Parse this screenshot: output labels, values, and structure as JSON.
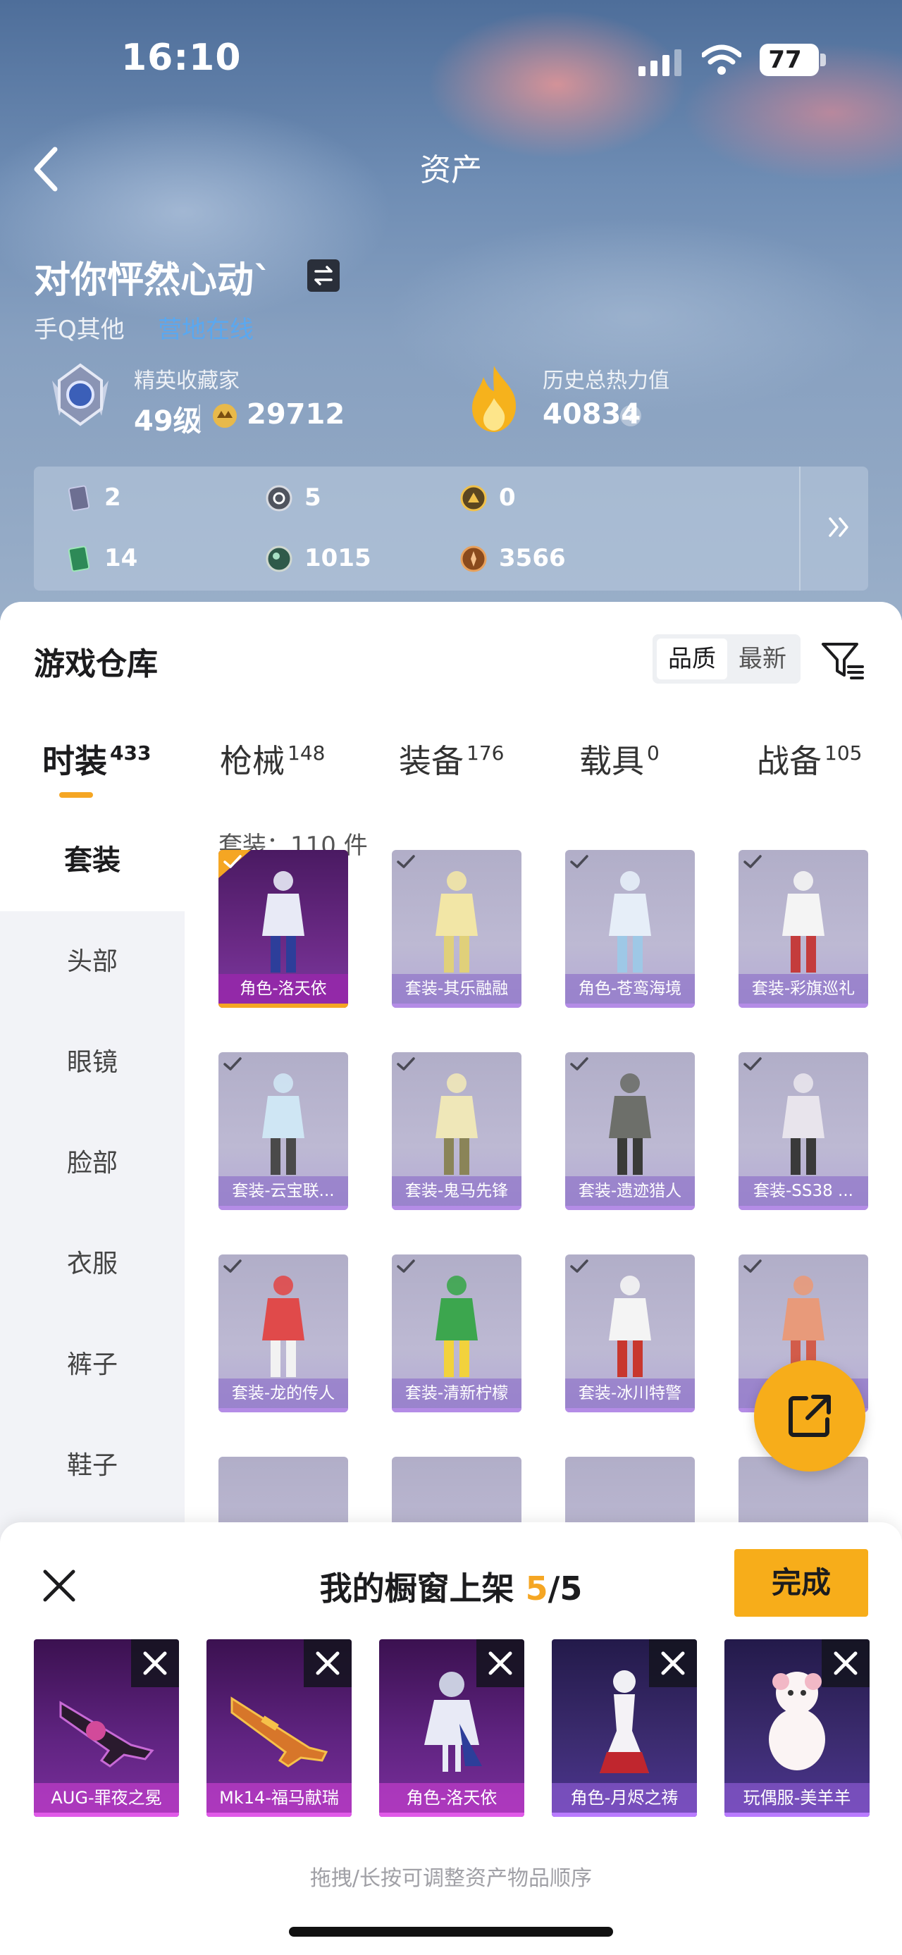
{
  "status_bar": {
    "time": "16:10",
    "battery": "77"
  },
  "header": {
    "title": "资产"
  },
  "profile": {
    "username": "对你怦然心动`",
    "account_source": "手Q其他",
    "account_link": "营地在线",
    "rank_label": "精英收藏家",
    "rank_level": "49级",
    "points": "29712",
    "heat_label": "历史总热力值",
    "heat_value": "40834",
    "help": "?"
  },
  "currencies": [
    {
      "icon": "card-icon",
      "value": "2"
    },
    {
      "icon": "coin-silver-icon",
      "value": "5"
    },
    {
      "icon": "coin-gold-icon",
      "value": "0"
    },
    {
      "icon": "ticket-icon",
      "value": "14"
    },
    {
      "icon": "orb-icon",
      "value": "1015"
    },
    {
      "icon": "bronze-coin-icon",
      "value": "3566"
    }
  ],
  "warehouse": {
    "title": "游戏仓库",
    "sort_options": [
      "品质",
      "最新"
    ],
    "tabs": [
      {
        "label": "时装",
        "count": "433"
      },
      {
        "label": "枪械",
        "count": "148"
      },
      {
        "label": "装备",
        "count": "176"
      },
      {
        "label": "载具",
        "count": "0"
      },
      {
        "label": "战备",
        "count": "105"
      }
    ],
    "categories": [
      "套装",
      "头部",
      "眼镜",
      "脸部",
      "衣服",
      "裤子",
      "鞋子"
    ],
    "count_text": "套装：110 件",
    "items": [
      {
        "label": "角色-洛天依",
        "state": "selected"
      },
      {
        "label": "套装-其乐融融",
        "state": "dim"
      },
      {
        "label": "角色-苍鸾海境",
        "state": "dim"
      },
      {
        "label": "套装-彩旗巡礼",
        "state": "dim"
      },
      {
        "label": "套装-云宝联...",
        "state": "dim"
      },
      {
        "label": "套装-鬼马先锋",
        "state": "dim"
      },
      {
        "label": "套装-遗迹猎人",
        "state": "dim"
      },
      {
        "label": "套装-SS38 ...",
        "state": "dim"
      },
      {
        "label": "套装-龙的传人",
        "state": "dim"
      },
      {
        "label": "套装-清新柠檬",
        "state": "dim"
      },
      {
        "label": "套装-冰川特警",
        "state": "dim"
      },
      {
        "label": "套",
        "state": "dim"
      }
    ]
  },
  "showcase": {
    "title": "我的橱窗上架",
    "count": "5",
    "total": "/5",
    "done_label": "完成",
    "hint": "拖拽/长按可调整资产物品顺序",
    "slots": [
      {
        "label": "AUG-罪夜之冕"
      },
      {
        "label": "Mk14-福马献瑞"
      },
      {
        "label": "角色-洛天依"
      },
      {
        "label": "角色-月烬之祷"
      },
      {
        "label": "玩偶服-美羊羊"
      }
    ]
  },
  "colors": {
    "accent": "#f5a623",
    "link": "#5aa8f0",
    "rarity_purple": "#7b3aa0"
  }
}
